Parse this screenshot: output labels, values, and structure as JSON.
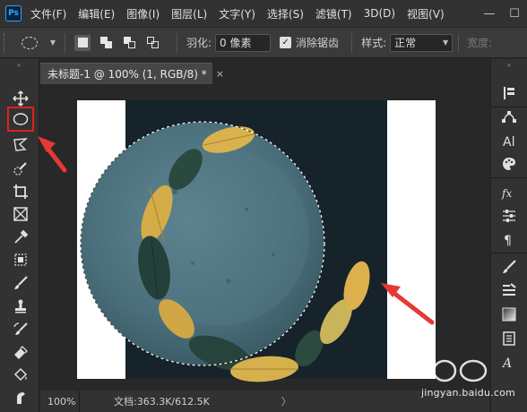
{
  "app": {
    "logo_text": "Ps"
  },
  "menu": [
    "文件(F)",
    "编辑(E)",
    "图像(I)",
    "图层(L)",
    "文字(Y)",
    "选择(S)",
    "滤镜(T)",
    "3D(D)",
    "视图(V)"
  ],
  "window_controls": {
    "minimize": "—",
    "restore": "☐"
  },
  "options": {
    "feather_label": "羽化:",
    "feather_value": "0 像素",
    "antialias_label": "消除锯齿",
    "antialias_checked": true,
    "style_label": "样式:",
    "style_value": "正常",
    "width_label": "宽度:"
  },
  "document": {
    "tab_title": "未标题-1 @ 100% (1, RGB/8) *",
    "tab_close": "×",
    "zoom": "100%",
    "doc_size": "文档:363.3K/612.5K",
    "status_arrow": "〉"
  },
  "annotation": {
    "color": "#e53935"
  },
  "colors": {
    "highlight": "#e02020",
    "accent": "#31a8ff",
    "plate": "#4d7380",
    "leaf_yellow": "#d8b04c",
    "leaf_green": "#27403a"
  },
  "watermark": {
    "text": "jingyan.baidu.com"
  }
}
